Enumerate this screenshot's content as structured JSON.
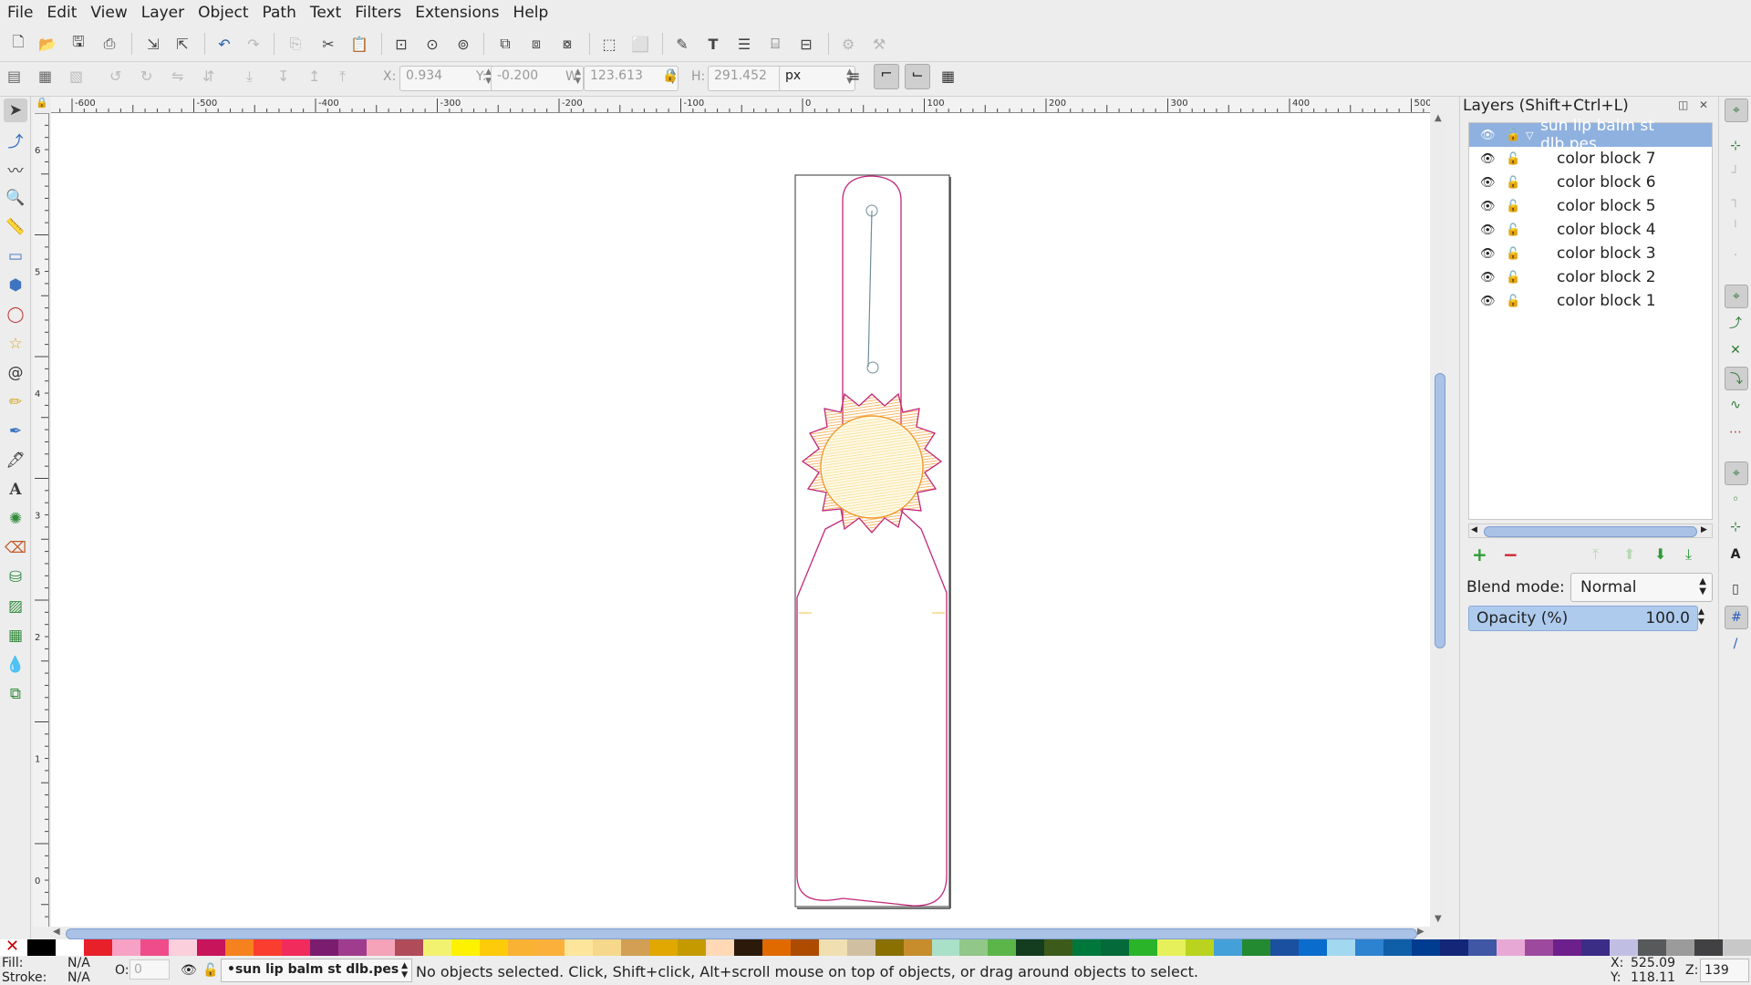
{
  "menu": [
    "File",
    "Edit",
    "View",
    "Layer",
    "Object",
    "Path",
    "Text",
    "Filters",
    "Extensions",
    "Help"
  ],
  "toolbar_controls": {
    "x_label": "X:",
    "x_value": "0.934",
    "y_label": "Y:",
    "y_value": "-0.200",
    "w_label": "W:",
    "w_value": "123.613",
    "h_label": "H:",
    "h_value": "291.452",
    "unit": "px"
  },
  "ruler": {
    "h_labels": [
      "-600",
      "-500",
      "-400",
      "-300",
      "-200",
      "-100",
      "0",
      "100",
      "200",
      "300",
      "400",
      "500"
    ],
    "v_labels": [
      "6",
      "5",
      "4",
      "3",
      "2",
      "1",
      "0"
    ]
  },
  "layers_panel": {
    "title": "Layers (Shift+Ctrl+L)",
    "root": "sun lip balm st dlb.pes",
    "layers": [
      "color block 7",
      "color block 6",
      "color block 5",
      "color block 4",
      "color block 3",
      "color block 2",
      "color block 1"
    ],
    "blend_label": "Blend mode:",
    "blend_value": "Normal",
    "opacity_label": "Opacity (%)",
    "opacity_value": "100.0"
  },
  "status": {
    "fill_label": "Fill:",
    "fill_value": "N/A",
    "stroke_label": "Stroke:",
    "stroke_value": "N/A",
    "o_label": "O:",
    "o_value": "0",
    "layer_selector": "•sun lip balm st dlb.pes",
    "message": "No objects selected. Click, Shift+click, Alt+scroll mouse on top of objects, or drag around objects to select.",
    "cursor_x_label": "X:",
    "cursor_x": "525.09",
    "cursor_y_label": "Y:",
    "cursor_y": "118.11",
    "zoom_label": "Z:",
    "zoom": "139"
  },
  "palette": [
    "#000000",
    "#ffffff",
    "#e8202a",
    "#f7a1c4",
    "#ef4c8c",
    "#fbd0dc",
    "#c8145a",
    "#f5821f",
    "#fa3d2f",
    "#f12b5b",
    "#7b1d6f",
    "#a03c8e",
    "#f4a3b9",
    "#b04b5a",
    "#f2f270",
    "#fff200",
    "#fecb0a",
    "#f9b234",
    "#fbb03b",
    "#fde69c",
    "#f5d88b",
    "#d29f55",
    "#e0a800",
    "#c59a00",
    "#ffd9b6",
    "#2b1a0a",
    "#e06a00",
    "#ad4c00",
    "#f0dfb0",
    "#d0bfa0",
    "#8a7000",
    "#c78d2d",
    "#a9e0c8",
    "#91c788",
    "#5bb548",
    "#133d1e",
    "#3c5b1a",
    "#00783c",
    "#046a3a",
    "#2ab42a",
    "#e6f05a",
    "#b9d31e",
    "#44a0d8",
    "#238a31",
    "#1b4fa0",
    "#0a6ccd",
    "#a2d8f0",
    "#2d83d0",
    "#0f5ea8",
    "#003c8f",
    "#132678",
    "#3f57a5",
    "#e7a8d5",
    "#9d4a9e",
    "#6d1f8c",
    "#3b2c86",
    "#c0bfe3",
    "#58595b",
    "#9b9b9b",
    "#414042",
    "#c8c8c8"
  ],
  "colors": {
    "selection": "#8fb1e0",
    "outline_magenta": "#c2267a",
    "sun_yellow": "#f6c24a",
    "sun_orange": "#f29a2c",
    "stitch_grey": "#6f8d95"
  }
}
